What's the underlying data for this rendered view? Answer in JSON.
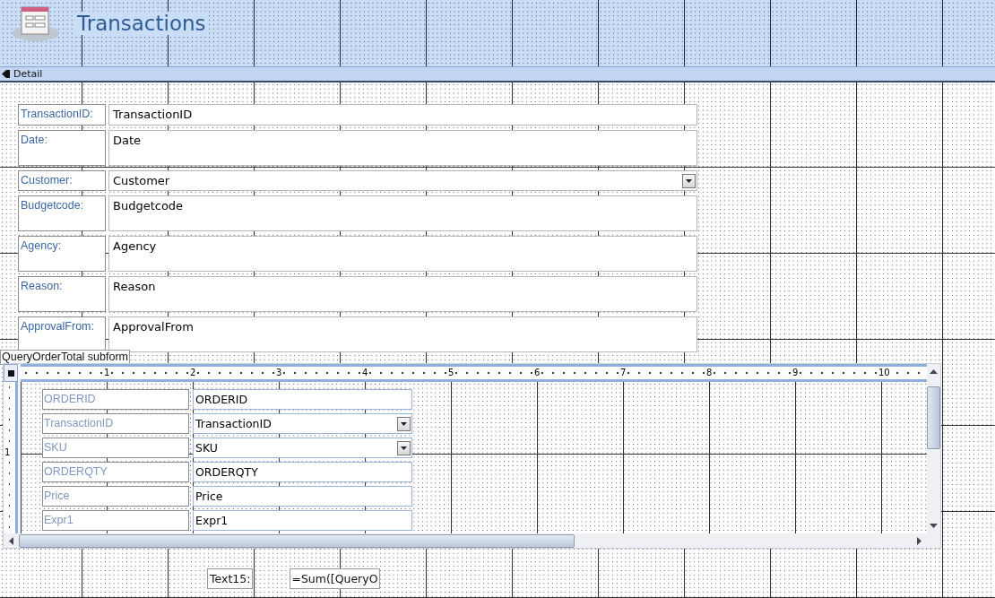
{
  "header": {
    "title": "Transactions"
  },
  "section": {
    "label": "Detail"
  },
  "fields": [
    {
      "label": "TransactionID:",
      "value": "TransactionID",
      "kind": "text"
    },
    {
      "label": "Date:",
      "value": "Date",
      "kind": "memo"
    },
    {
      "label": "Customer:",
      "value": "Customer",
      "kind": "combo"
    },
    {
      "label": "Budgetcode:",
      "value": "Budgetcode",
      "kind": "memo"
    },
    {
      "label": "Agency:",
      "value": "Agency",
      "kind": "memo"
    },
    {
      "label": "Reason:",
      "value": "Reason",
      "kind": "memo"
    },
    {
      "label": "ApprovalFrom:",
      "value": "ApprovalFrom",
      "kind": "memo"
    }
  ],
  "subform": {
    "label": "QueryOrderTotal subform",
    "ruler": [
      "1",
      "2",
      "3",
      "4",
      "5",
      "6",
      "7",
      "8",
      "9",
      "10"
    ],
    "side_ruler": [
      "1"
    ],
    "fields": [
      {
        "label": "ORDERID",
        "value": "ORDERID",
        "kind": "text"
      },
      {
        "label": "TransactionID",
        "value": "TransactionID",
        "kind": "combo"
      },
      {
        "label": "SKU",
        "value": "SKU",
        "kind": "combo"
      },
      {
        "label": "ORDERQTY",
        "value": "ORDERQTY",
        "kind": "text"
      },
      {
        "label": "Price",
        "value": "Price",
        "kind": "text"
      },
      {
        "label": "Expr1",
        "value": "Expr1",
        "kind": "text"
      }
    ]
  },
  "footer_control": {
    "label": "Text15:",
    "value": "=Sum([QueryO"
  }
}
